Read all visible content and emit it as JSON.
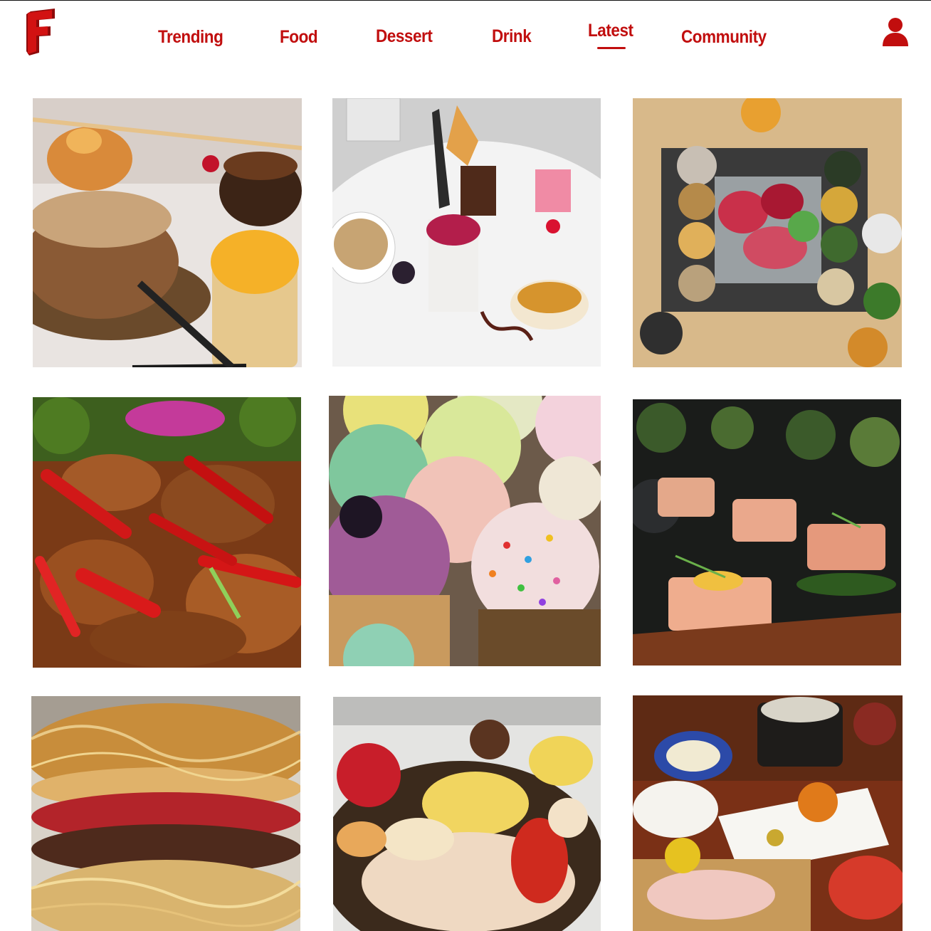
{
  "brand": {
    "logo_letter": "F",
    "color": "#c10e0e"
  },
  "nav": {
    "items": [
      {
        "label": "Trending"
      },
      {
        "label": "Food"
      },
      {
        "label": "Dessert"
      },
      {
        "label": "Drink"
      },
      {
        "label": "Latest",
        "active": true
      },
      {
        "label": "Community"
      }
    ]
  },
  "header": {
    "profile_icon": "user-icon"
  },
  "grid": {
    "columns": 3,
    "tiles": [
      {
        "subject": "plated chocolate mousse dessert trio"
      },
      {
        "subject": "dessert sampler plate with coffee"
      },
      {
        "subject": "korean bbq table with side dishes"
      },
      {
        "subject": "fried chicken with red chili peppers"
      },
      {
        "subject": "assorted frosted cupcakes"
      },
      {
        "subject": "seared salmon bites on dark plates"
      },
      {
        "subject": "crispy noodle burger"
      },
      {
        "subject": "lobster eggs benedict"
      },
      {
        "subject": "japanese kaiseki spread"
      }
    ]
  }
}
